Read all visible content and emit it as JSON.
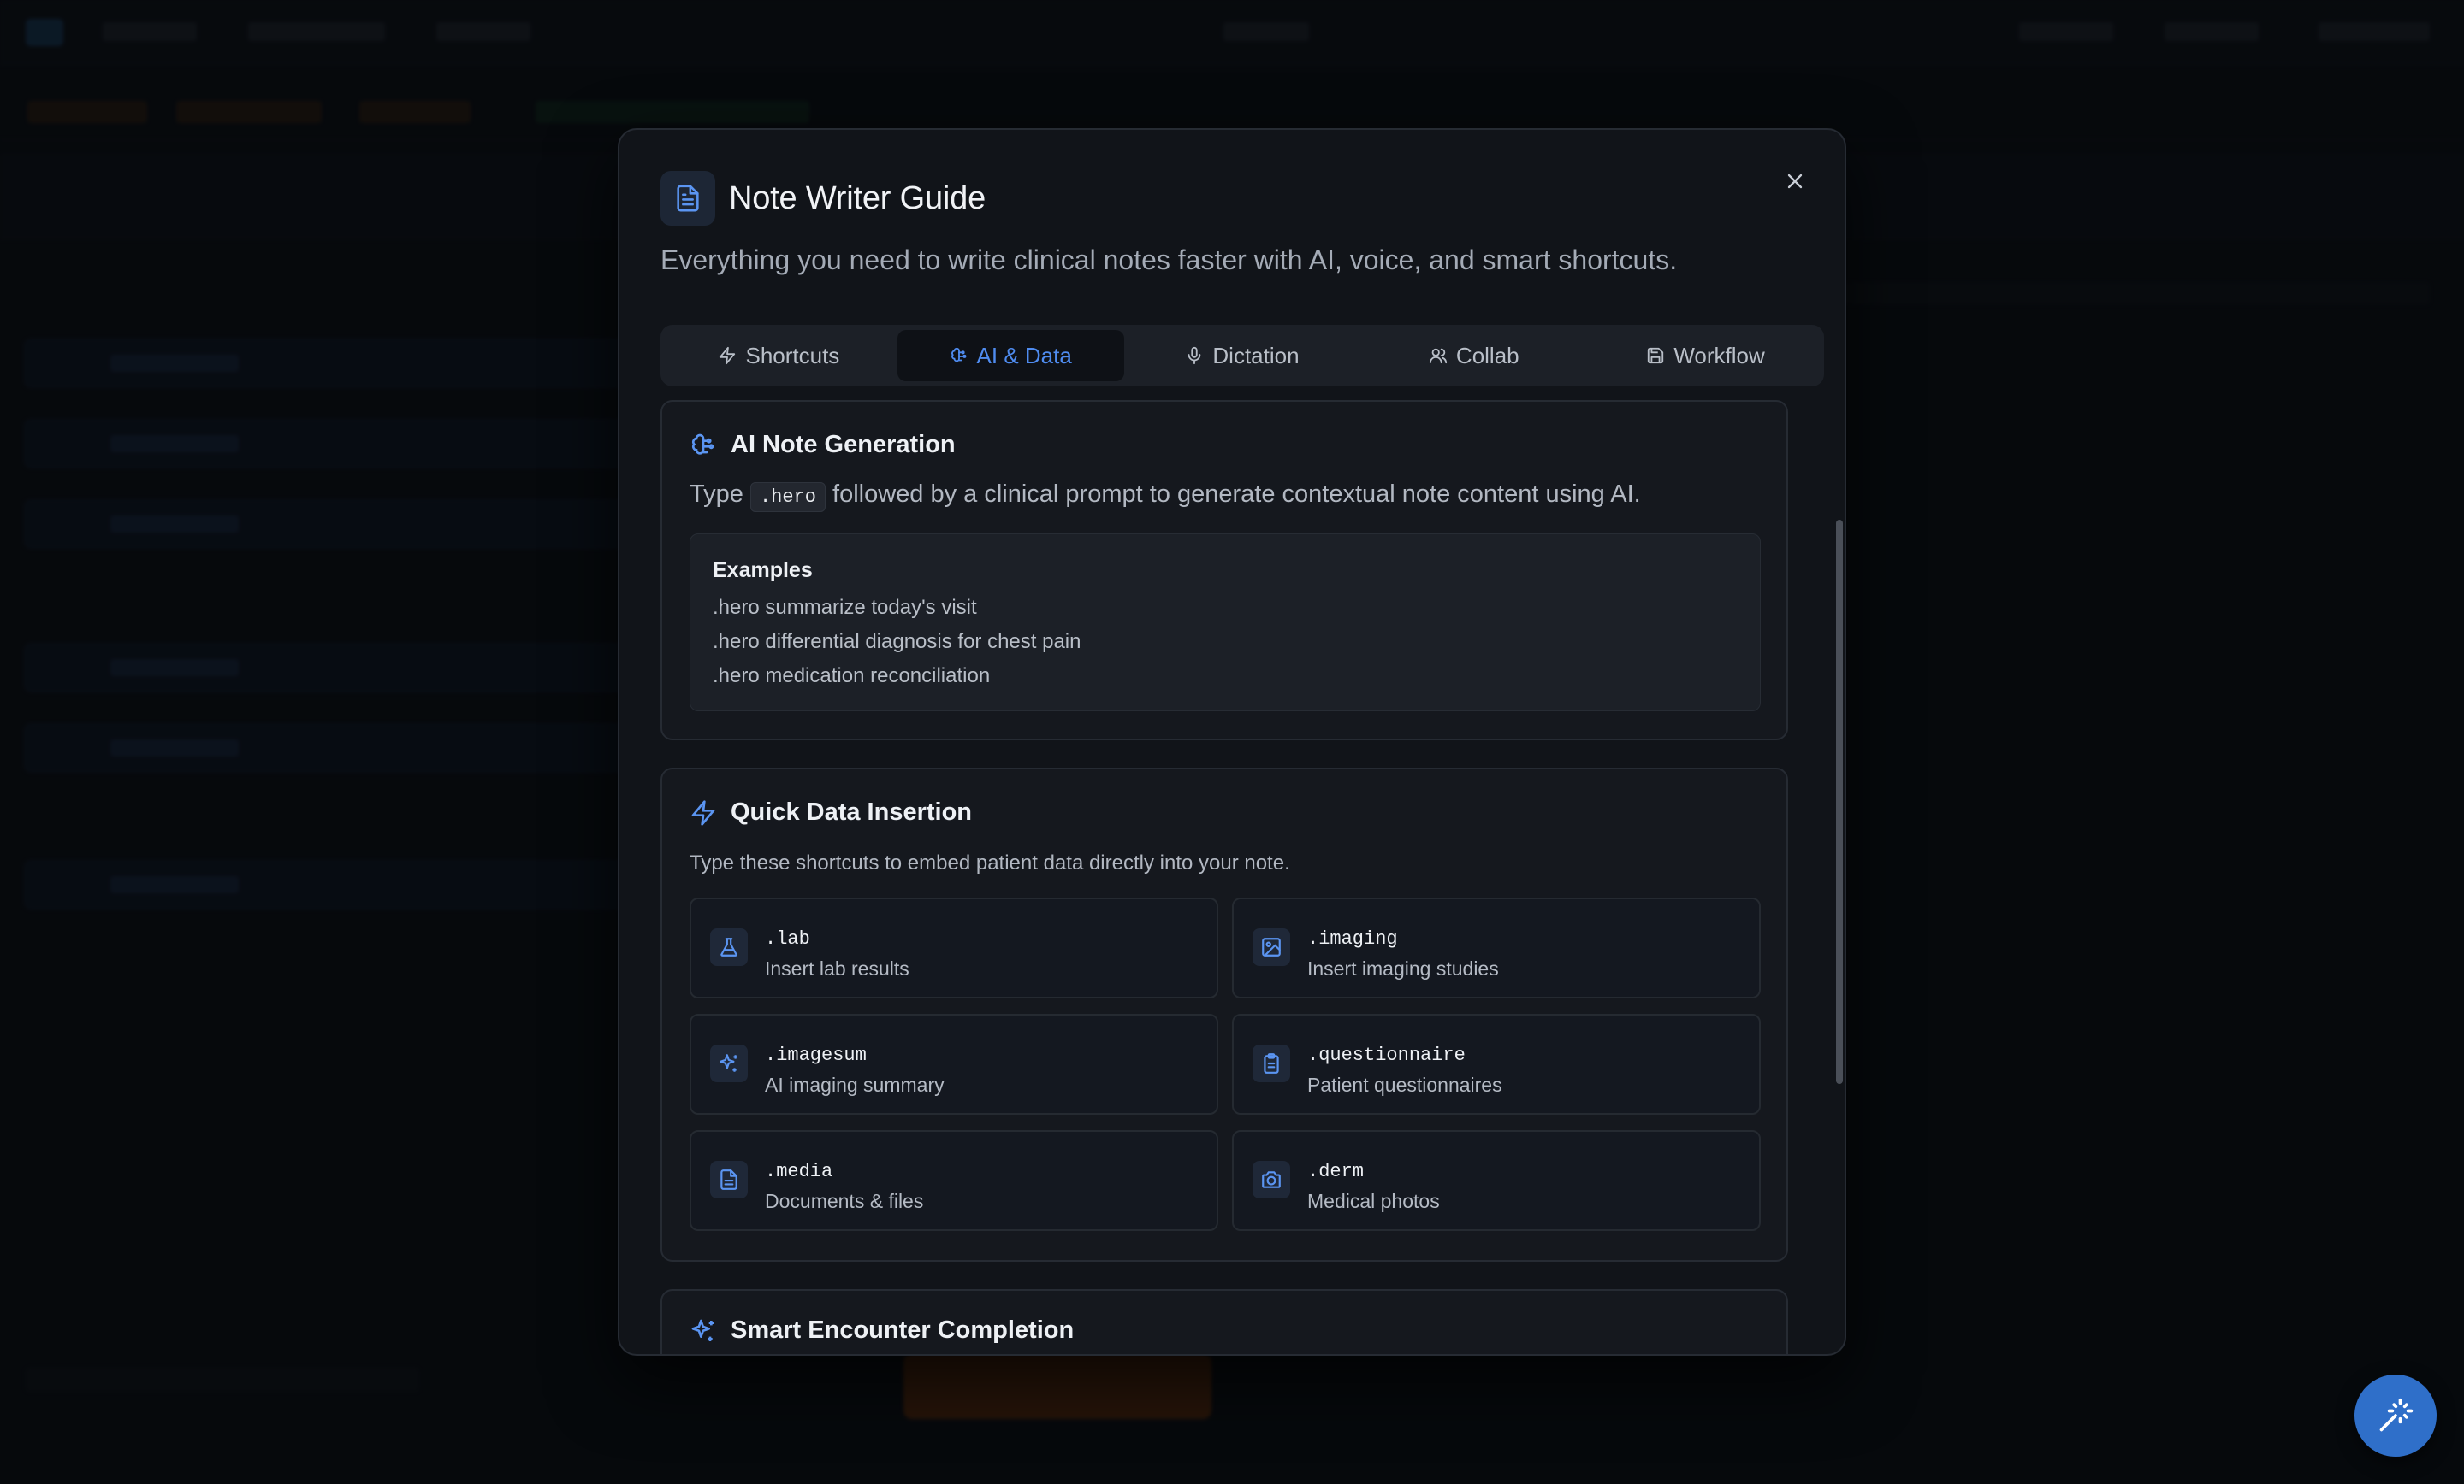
{
  "modal": {
    "title": "Note Writer Guide",
    "subtitle": "Everything you need to write clinical notes faster with AI, voice, and smart shortcuts."
  },
  "tabs": [
    {
      "label": "Shortcuts",
      "icon": "lightning-icon",
      "active": false
    },
    {
      "label": "AI & Data",
      "icon": "brain-icon",
      "active": true
    },
    {
      "label": "Dictation",
      "icon": "microphone-icon",
      "active": false
    },
    {
      "label": "Collab",
      "icon": "users-icon",
      "active": false
    },
    {
      "label": "Workflow",
      "icon": "save-icon",
      "active": false
    }
  ],
  "ai_card": {
    "title": "AI Note Generation",
    "desc_prefix": "Type",
    "command": ".hero",
    "desc_suffix": "followed by a clinical prompt to generate contextual note content using AI.",
    "examples_title": "Examples",
    "examples": [
      ".hero summarize today's visit",
      ".hero differential diagnosis for chest pain",
      ".hero medication reconciliation"
    ]
  },
  "data_card": {
    "title": "Quick Data Insertion",
    "desc": "Type these shortcuts to embed patient data directly into your note.",
    "shortcuts": [
      {
        "code": ".lab",
        "label": "Insert lab results",
        "icon": "flask-icon"
      },
      {
        "code": ".imaging",
        "label": "Insert imaging studies",
        "icon": "image-icon"
      },
      {
        "code": ".imagesum",
        "label": "AI imaging summary",
        "icon": "sparkles-icon"
      },
      {
        "code": ".questionnaire",
        "label": "Patient questionnaires",
        "icon": "clipboard-icon"
      },
      {
        "code": ".media",
        "label": "Documents & files",
        "icon": "document-icon"
      },
      {
        "code": ".derm",
        "label": "Medical photos",
        "icon": "camera-icon"
      }
    ]
  },
  "encounter_card": {
    "title": "Smart Encounter Completion"
  },
  "colors": {
    "accent": "#4f8cf0",
    "background": "#0b0e13",
    "modal": "#111419",
    "fab": "#2f6fc9"
  }
}
